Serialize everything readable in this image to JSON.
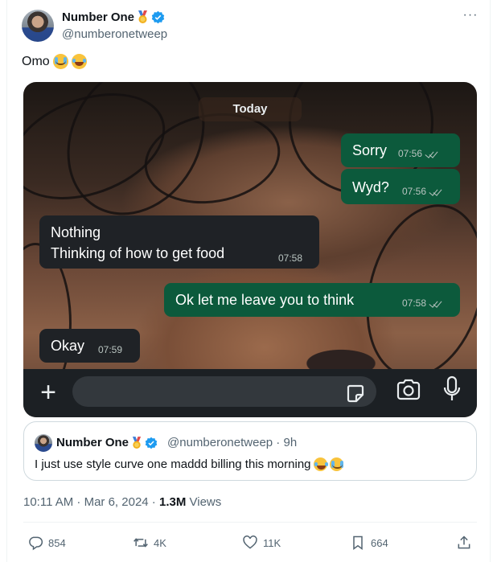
{
  "author": {
    "name": "Number One",
    "handle": "@numberonetweep",
    "badge_icon": "medal-icon",
    "verified_icon": "verified-badge-icon"
  },
  "tweet": {
    "text": "Omo",
    "emojis": [
      "loudly-crying-face",
      "face-with-tears-of-joy"
    ]
  },
  "chat": {
    "date_chip": "Today",
    "messages": [
      {
        "direction": "out",
        "text": "Sorry",
        "time": "07:56",
        "status": "read"
      },
      {
        "direction": "out",
        "text": "Wyd?",
        "time": "07:56",
        "status": "read"
      },
      {
        "direction": "in",
        "line1": "Nothing",
        "line2": "Thinking of how to get food",
        "time": "07:58"
      },
      {
        "direction": "out",
        "text": "Ok let me leave you to think",
        "time": "07:58",
        "status": "read"
      },
      {
        "direction": "in",
        "text": "Okay",
        "time": "07:59"
      }
    ],
    "outgoing_color": "#0c5a3c",
    "incoming_color": "#1f2226"
  },
  "quote": {
    "name": "Number One",
    "handle_time": "@numberonetweep · 9h",
    "text": "I just use style curve one maddd billing this morning"
  },
  "meta": {
    "time_date": "10:11 AM · Mar 6, 2024 · ",
    "views_count": "1.3M",
    "views_label": " Views"
  },
  "actions": {
    "replies": "854",
    "reposts": "4K",
    "likes": "11K",
    "bookmarks": "664"
  },
  "colors": {
    "verified": "#1d9bf0",
    "text_secondary": "#536471"
  }
}
